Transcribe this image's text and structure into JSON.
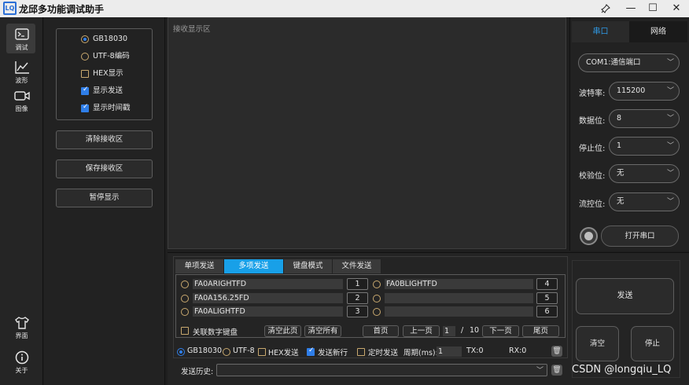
{
  "window": {
    "title": "龙邱多功能调试助手",
    "logo_text": "LQ"
  },
  "nav": {
    "debug": "调试",
    "waveform": "波形",
    "image": "图像",
    "ui": "界面",
    "about": "关于"
  },
  "options": {
    "gb18030": "GB18030",
    "utf8": "UTF-8编码",
    "hex": "HEX显示",
    "show_send": "显示发送",
    "show_time": "显示时间戳",
    "clear_btn": "清除接收区",
    "save_btn": "保存接收区",
    "pause_btn": "暂停显示"
  },
  "receive": {
    "placeholder": "接收显示区"
  },
  "settings": {
    "tabs": [
      "串口",
      "网络"
    ],
    "port": "COM1:通信端口",
    "baud_label": "波特率:",
    "baud": "115200",
    "data_label": "数据位:",
    "data": "8",
    "stop_label": "停止位:",
    "stop": "1",
    "parity_label": "校验位:",
    "parity": "无",
    "flow_label": "流控位:",
    "flow": "无",
    "open_btn": "打开串口"
  },
  "send": {
    "tabs": [
      "单项发送",
      "多项发送",
      "键盘模式",
      "文件发送"
    ],
    "rows_left": [
      {
        "text": "FA0ARIGHTFD",
        "num": "1"
      },
      {
        "text": "FA0A156.25FD",
        "num": "2"
      },
      {
        "text": "FA0ALIGHTFD",
        "num": "3"
      }
    ],
    "rows_right": [
      {
        "text": "FA0BLIGHTFD",
        "num": "4"
      },
      {
        "text": "",
        "num": "5"
      },
      {
        "text": "",
        "num": "6"
      }
    ],
    "keyboard_link": "关联数字键盘",
    "clear_page": "清空此页",
    "clear_all": "清空所有",
    "first": "首页",
    "prev": "上一页",
    "page": "1",
    "page_sep": "/",
    "page_total": "10",
    "next": "下一页",
    "last": "尾页",
    "enc_gb": "GB18030",
    "enc_utf": "UTF-8",
    "hex_send": "HEX发送",
    "newline": "发送新行",
    "timed": "定时发送",
    "period_label": "周期(ms):",
    "period": "1",
    "tx": "TX:0",
    "rx": "RX:0",
    "history_label": "发送历史:",
    "send_btn": "发送",
    "clear_btn": "清空",
    "stop_btn": "停止"
  },
  "watermark": "CSDN @longqiu_LQ",
  "colors": {
    "accent": "#18a0e8",
    "checkbox": "#2f7ee8",
    "radio_border": "#c8a86e"
  }
}
